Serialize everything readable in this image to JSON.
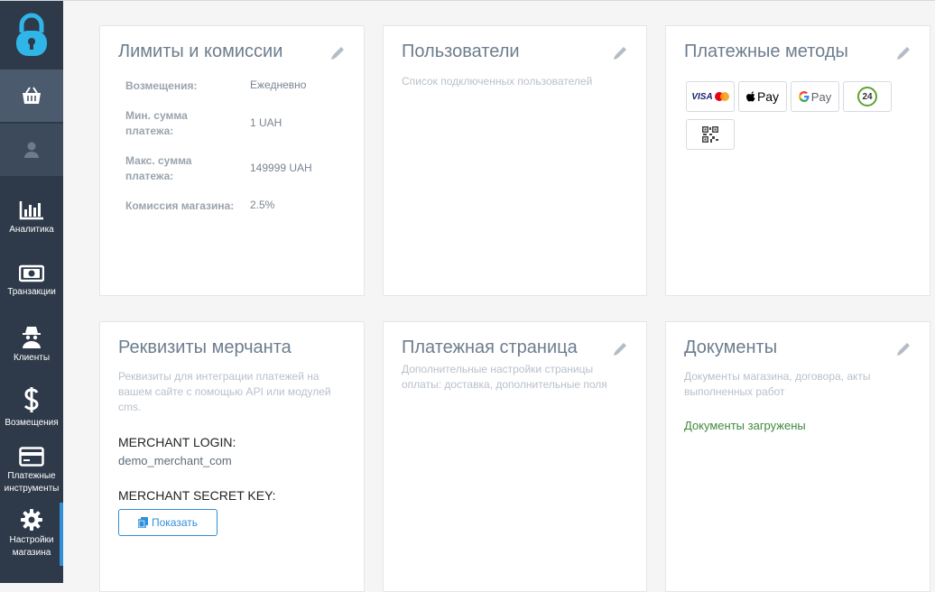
{
  "sidebar": {
    "items": [
      {
        "label": "Аналитика",
        "icon": "bar-chart-icon"
      },
      {
        "label": "Транзакции",
        "icon": "money-icon"
      },
      {
        "label": "Клиенты",
        "icon": "incognito-user-icon"
      },
      {
        "label": "Возмещения",
        "icon": "dollar-icon"
      },
      {
        "label": "Платежные инструменты",
        "icon": "credit-card-icon"
      },
      {
        "label": "Настройки магазина",
        "icon": "gear-icon"
      }
    ]
  },
  "limits": {
    "title": "Лимиты и комиссии",
    "rows": [
      {
        "key": "Возмещения:",
        "value": "Ежедневно"
      },
      {
        "key": "Мин. сумма платежа:",
        "value": "1 UAH"
      },
      {
        "key": "Макс. сумма платежа:",
        "value": "149999 UAH"
      },
      {
        "key": "Комиссия магазина:",
        "value": "2.5%"
      }
    ]
  },
  "users": {
    "title": "Пользователи",
    "description": "Список подключенных пользователей"
  },
  "payment_methods": {
    "title": "Платежные методы",
    "methods": [
      "VISA",
      "Pay",
      "Pay",
      "24"
    ]
  },
  "merchant": {
    "title": "Реквизиты мерчанта",
    "description": "Реквизиты для интеграции платежей на вашем сайте с помощью API или модулей cms.",
    "login_label": "MERCHANT LOGIN:",
    "login_value": "demo_merchant_com",
    "secret_label": "MERCHANT SECRET KEY:",
    "show_button": "Показать"
  },
  "payment_page": {
    "title": "Платежная страница",
    "description": "Дополнительные настройки страницы оплаты: доставка, дополнительные поля"
  },
  "documents": {
    "title": "Документы",
    "description": "Документы магазина, договора, акты выполненных работ",
    "status": "Документы загружены"
  },
  "colors": {
    "sidebar": "#2e3a4a",
    "accent": "#2f8fd8",
    "success": "#3f8a3f"
  }
}
